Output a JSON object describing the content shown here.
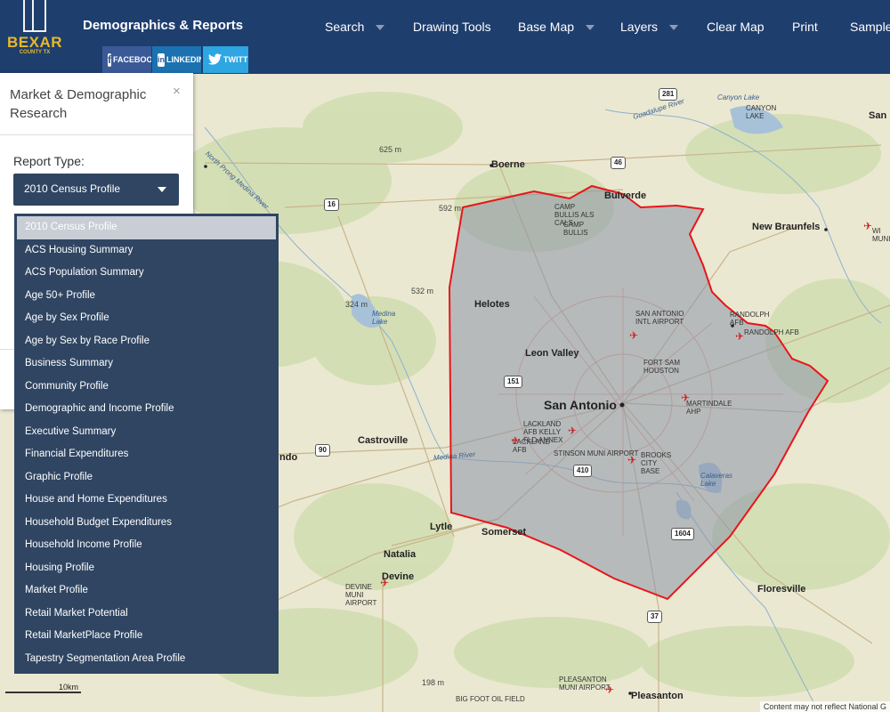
{
  "header": {
    "logo_text": "BEXAR",
    "logo_sub": "COUNTY TX",
    "title": "Demographics & Reports",
    "social": [
      {
        "label": "FACEBOOK",
        "icon": "f"
      },
      {
        "label": "LINKEDIN",
        "icon": "in"
      },
      {
        "label": "TWITTER",
        "icon": "t"
      }
    ],
    "nav": [
      {
        "label": "Search",
        "has_caret": true
      },
      {
        "label": "Drawing Tools",
        "has_caret": false
      },
      {
        "label": "Base Map",
        "has_caret": true
      },
      {
        "label": "Layers",
        "has_caret": true
      },
      {
        "label": "Clear Map",
        "has_caret": false
      },
      {
        "label": "Print",
        "has_caret": false
      },
      {
        "label": "Sample",
        "has_caret": false
      }
    ]
  },
  "panel": {
    "title": "Market & Demographic Research",
    "close": "×",
    "report_type_label": "Report Type:",
    "selected_report": "2010 Census Profile"
  },
  "dropdown": {
    "selected_index": 0,
    "options": [
      "2010 Census Profile",
      "ACS Housing Summary",
      "ACS Population Summary",
      "Age 50+ Profile",
      "Age by Sex Profile",
      "Age by Sex by Race Profile",
      "Business Summary",
      "Community Profile",
      "Demographic and Income Profile",
      "Executive Summary",
      "Financial Expenditures",
      "Graphic Profile",
      "House and Home Expenditures",
      "Household Budget Expenditures",
      "Household Income Profile",
      "Housing Profile",
      "Market Profile",
      "Retail Market Potential",
      "Retail MarketPlace Profile",
      "Tapestry Segmentation Area Profile"
    ]
  },
  "map": {
    "places": {
      "boerne": "Boerne",
      "bulverde": "Bulverde",
      "new_braunfels": "New Braunfels",
      "helotes": "Helotes",
      "leon_valley": "Leon Valley",
      "san_antonio": "San Antonio",
      "castroville": "Castroville",
      "lytle": "Lytle",
      "somerset": "Somerset",
      "natalia": "Natalia",
      "devine": "Devine",
      "floresville": "Floresville",
      "pleasanton": "Pleasanton",
      "ndo": "ndo",
      "san_partial": "San"
    },
    "features": {
      "camp_bullis_als": "CAMP BULLIS ALS CALS",
      "camp_bullis": "CAMP BULLIS",
      "sa_airport": "SAN ANTONIO INTL AIRPORT",
      "fort_sam": "FORT SAM HOUSTON",
      "randolph": "RANDOLPH AFB",
      "randolph2": "RANDOLPH AFB",
      "martindale": "MARTINDALE AHP",
      "lackland_kelly": "LACKLAND AFB KELLY FLD ANNEX",
      "lackland": "LACKLAND AFB",
      "stinson": "STINSON MUNI AIRPORT",
      "brooks": "BROOKS CITY BASE",
      "devine_airport": "DEVINE MUNI AIRPORT",
      "pleasanton_airport": "PLEASANTON MUNI AIRPORT",
      "big_foot": "BIG FOOT OIL FIELD",
      "canyon_lake": "Canyon Lake",
      "canyon_lake2": "CANYON LAKE",
      "medina_lake": "Medina Lake",
      "calaveras": "Calaveras Lake",
      "guadalupe": "Guadalupe River",
      "medina_river": "Medina River",
      "north_prong": "North Prong Medina River",
      "wimi": "WI MUNI"
    },
    "elevations": [
      "625 m",
      "592 m",
      "532 m",
      "324 m",
      "198 m"
    ],
    "shields": [
      "281",
      "46",
      "16",
      "151",
      "90",
      "410",
      "1604",
      "37"
    ],
    "scale_label": "10km",
    "attribution": "Content may not reflect National G"
  },
  "colors": {
    "header_bg": "#1e3e6e",
    "accent_gold": "#e8b82a",
    "panel_select_bg": "#2f4562",
    "county_boundary": "#e8151a",
    "county_fill": "#8c93a8"
  }
}
